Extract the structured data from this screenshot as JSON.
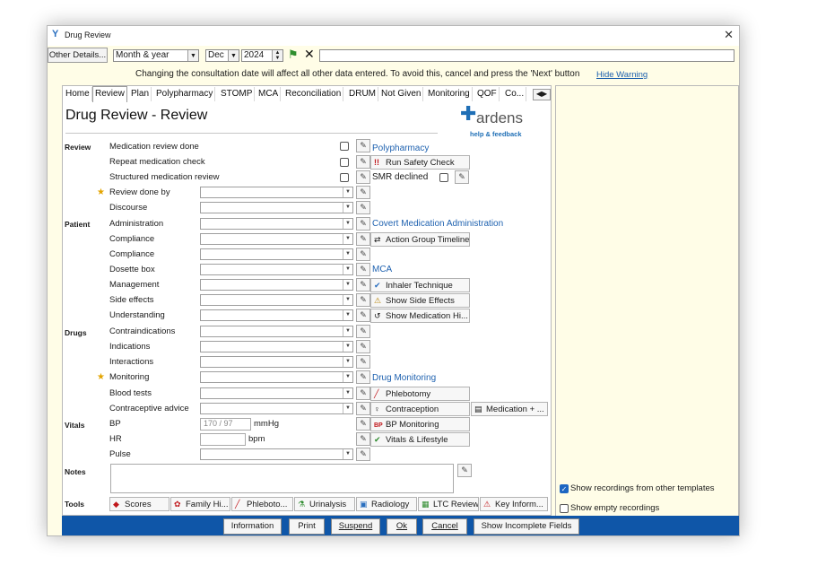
{
  "window": {
    "title": "Drug Review",
    "close_glyph": "✕"
  },
  "toolbar": {
    "other_details": "Other Details...",
    "date_mode": "Month & year",
    "month": "Dec",
    "year": "2024",
    "search_value": ""
  },
  "warning": {
    "text": "Changing the consultation date will affect all other data entered. To avoid this, cancel and press the 'Next' button",
    "hide_link": "Hide Warning"
  },
  "tabs": [
    "Home",
    "Review",
    "Plan",
    "Polypharmacy",
    "STOMP",
    "MCA",
    "Reconciliation",
    "DRUM",
    "Not Given",
    "Monitoring",
    "QOF",
    "Co..."
  ],
  "active_tab": "Review",
  "page_title": "Drug Review - Review",
  "logo": {
    "word": "ardens",
    "sub": "help & feedback"
  },
  "sections": {
    "review": "Review",
    "patient": "Patient",
    "drugs": "Drugs",
    "vitals": "Vitals",
    "notes": "Notes",
    "tools": "Tools"
  },
  "fields": {
    "med_review": "Medication review done",
    "repeat_check": "Repeat medication check",
    "structured": "Structured medication review",
    "review_by": "Review done by",
    "discourse": "Discourse",
    "administration": "Administration",
    "compliance1": "Compliance",
    "compliance2": "Compliance",
    "dosette": "Dosette box",
    "management": "Management",
    "side_effects": "Side effects",
    "understanding": "Understanding",
    "contraindications": "Contraindications",
    "indications": "Indications",
    "interactions": "Interactions",
    "monitoring": "Monitoring",
    "blood_tests": "Blood tests",
    "contraceptive": "Contraceptive advice",
    "bp": "BP",
    "bp_placeholder": "170 / 97",
    "bp_unit": "mmHg",
    "hr": "HR",
    "hr_unit": "bpm",
    "pulse": "Pulse"
  },
  "groups": {
    "polypharmacy": "Polypharmacy",
    "covert": "Covert Medication Administration",
    "mca": "MCA",
    "drug_monitoring": "Drug Monitoring"
  },
  "actions": {
    "safety": "Run Safety Check",
    "smr_declined": "SMR declined",
    "action_group": "Action Group Timeline",
    "inhaler": "Inhaler Technique",
    "side_effects": "Show Side Effects",
    "med_history": "Show Medication Hi...",
    "phlebotomy": "Phlebotomy",
    "contraception": "Contraception",
    "medication_plus": "Medication + ...",
    "bp_monitoring": "BP Monitoring",
    "vitals_lifestyle": "Vitals & Lifestyle"
  },
  "tools": [
    "Scores",
    "Family Hi...",
    "Phleboto...",
    "Urinalysis",
    "Radiology",
    "LTC Review",
    "Key Inform..."
  ],
  "right_panel": {
    "show_other": "Show recordings from other templates",
    "show_empty": "Show empty recordings"
  },
  "footer": {
    "information": "Information",
    "print": "Print",
    "suspend": "Suspend",
    "ok": "Ok",
    "cancel": "Cancel",
    "incomplete": "Show Incomplete Fields"
  }
}
